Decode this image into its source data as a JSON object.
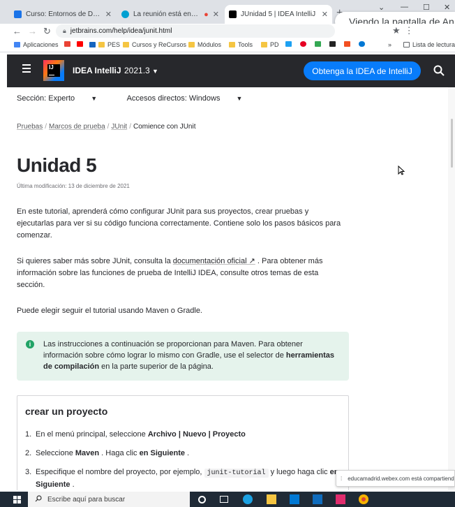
{
  "browser": {
    "tabs": [
      {
        "title": "Curso: Entornos de Desarrollo",
        "favicon_color": "#1a73e8"
      },
      {
        "title": "La reunión está en curso...",
        "favicon_color": "#00a0d1"
      },
      {
        "title": "JUnidad 5 | IDEA IntelliJ",
        "favicon_color": "#000000"
      }
    ],
    "screen_share_banner": "Viendo la pantalla de An",
    "url": "jetbrains.com/help/idea/junit.html",
    "bookmarks": [
      "Aplicaciones",
      "PES",
      "Cursos y ReCursos",
      "Módulos",
      "Tools",
      "PD",
      "Lista de lectura"
    ]
  },
  "header": {
    "product": "IDEA IntelliJ",
    "version": "2021.3",
    "cta": "Obtenga la IDEA de IntelliJ",
    "logo_text": "IJ"
  },
  "page": {
    "section": "Sección: Experto",
    "shortcuts": "Accesos directos: Windows",
    "breadcrumbs": [
      "Pruebas",
      "Marcos de prueba",
      "JUnit",
      "Comience con JUnit"
    ],
    "title": "Unidad 5",
    "last_modified": "Última modificación: 13 de diciembre de 2021",
    "intro": "En este tutorial, aprenderá cómo configurar JUnit para sus proyectos, crear pruebas y ejecutarlas para ver si su código funciona correctamente. Contiene solo los pasos básicos para comenzar.",
    "docs_prefix": "Si quieres saber más sobre JUnit, consulta la ",
    "docs_link": "documentación oficial ↗",
    "docs_suffix": " . Para obtener más información sobre las funciones de prueba de IntelliJ IDEA, consulte otros temas de esta sección.",
    "choose": "Puede elegir seguir el tutorial usando Maven o Gradle.",
    "note_prefix": "Las instrucciones a continuación se proporcionan para Maven. Para obtener información sobre cómo lograr lo mismo con Gradle, use el selector de ",
    "note_bold": "herramientas de compilación",
    "note_suffix": " en la parte superior de la página.",
    "card_title": "crear un proyecto",
    "step1_text": "En el menú principal, seleccione ",
    "step1_bold": "Archivo | Nuevo | Proyecto",
    "step2_text": "Seleccione ",
    "step2_bold1": "Maven",
    "step2_mid": " . Haga clic ",
    "step2_bold2": "en Siguiente",
    "step2_end": " .",
    "step3_text": "Especifique el nombre del proyecto, por ejemplo, ",
    "step3_code": "junit-tutorial",
    "step3_mid": " y luego haga clic ",
    "step3_bold": "en Siguiente",
    "step3_end": " ."
  },
  "webex_toast": "educamadrid.webex.com está compartiendo",
  "taskbar": {
    "search_placeholder": "Escribe aquí para buscar"
  }
}
